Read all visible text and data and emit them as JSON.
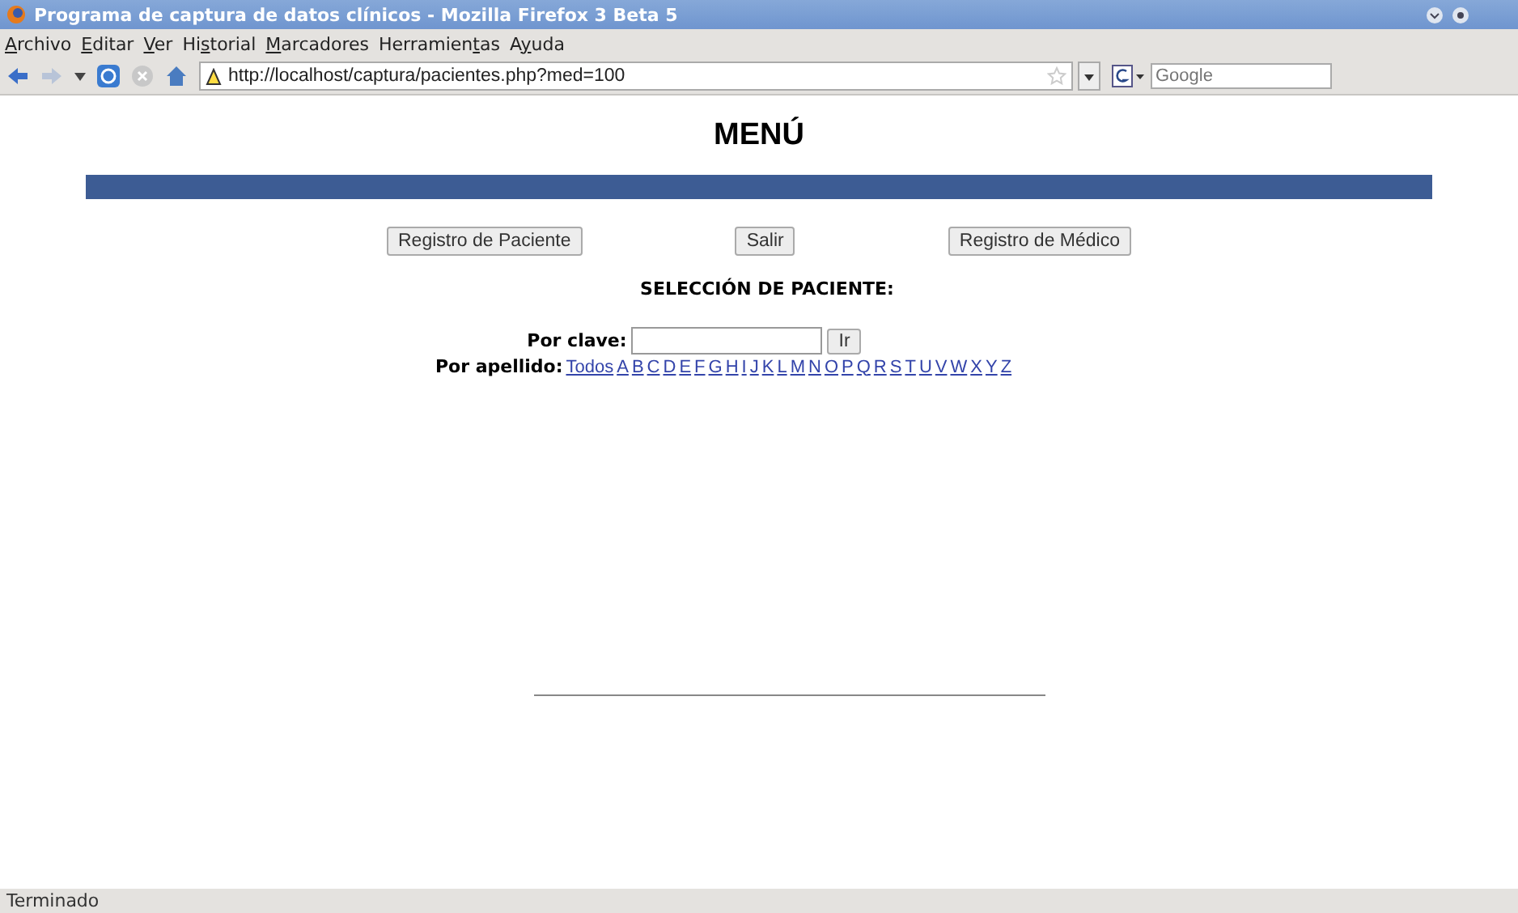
{
  "window": {
    "title": "Programa de captura de datos clínicos - Mozilla Firefox 3 Beta 5"
  },
  "menu": [
    {
      "key": "A",
      "after": "rchivo"
    },
    {
      "key": "E",
      "after": "ditar"
    },
    {
      "key": "V",
      "after": "er"
    },
    {
      "before": "Hi",
      "key": "s",
      "after": "torial"
    },
    {
      "key": "M",
      "after": "arcadores"
    },
    {
      "before": "Herramien",
      "key": "t",
      "after": "as"
    },
    {
      "before": "A",
      "key": "y",
      "after": "uda"
    }
  ],
  "address": {
    "value": "http://localhost/captura/pacientes.php?med=100"
  },
  "search": {
    "placeholder": "Google"
  },
  "page": {
    "heading": "MENÚ",
    "buttons": [
      "Registro de Paciente",
      "Salir",
      "Registro de Médico"
    ],
    "section_title": "SELECCIÓN DE PACIENTE:",
    "by_key_label": "Por clave:",
    "go_button": "Ir",
    "by_surname_label": "Por apellido:",
    "letters": [
      "Todos",
      "A",
      "B",
      "C",
      "D",
      "E",
      "F",
      "G",
      "H",
      "I",
      "J",
      "K",
      "L",
      "M",
      "N",
      "O",
      "P",
      "Q",
      "R",
      "S",
      "T",
      "U",
      "V",
      "W",
      "X",
      "Y",
      "Z"
    ]
  },
  "status_bar": "Terminado"
}
